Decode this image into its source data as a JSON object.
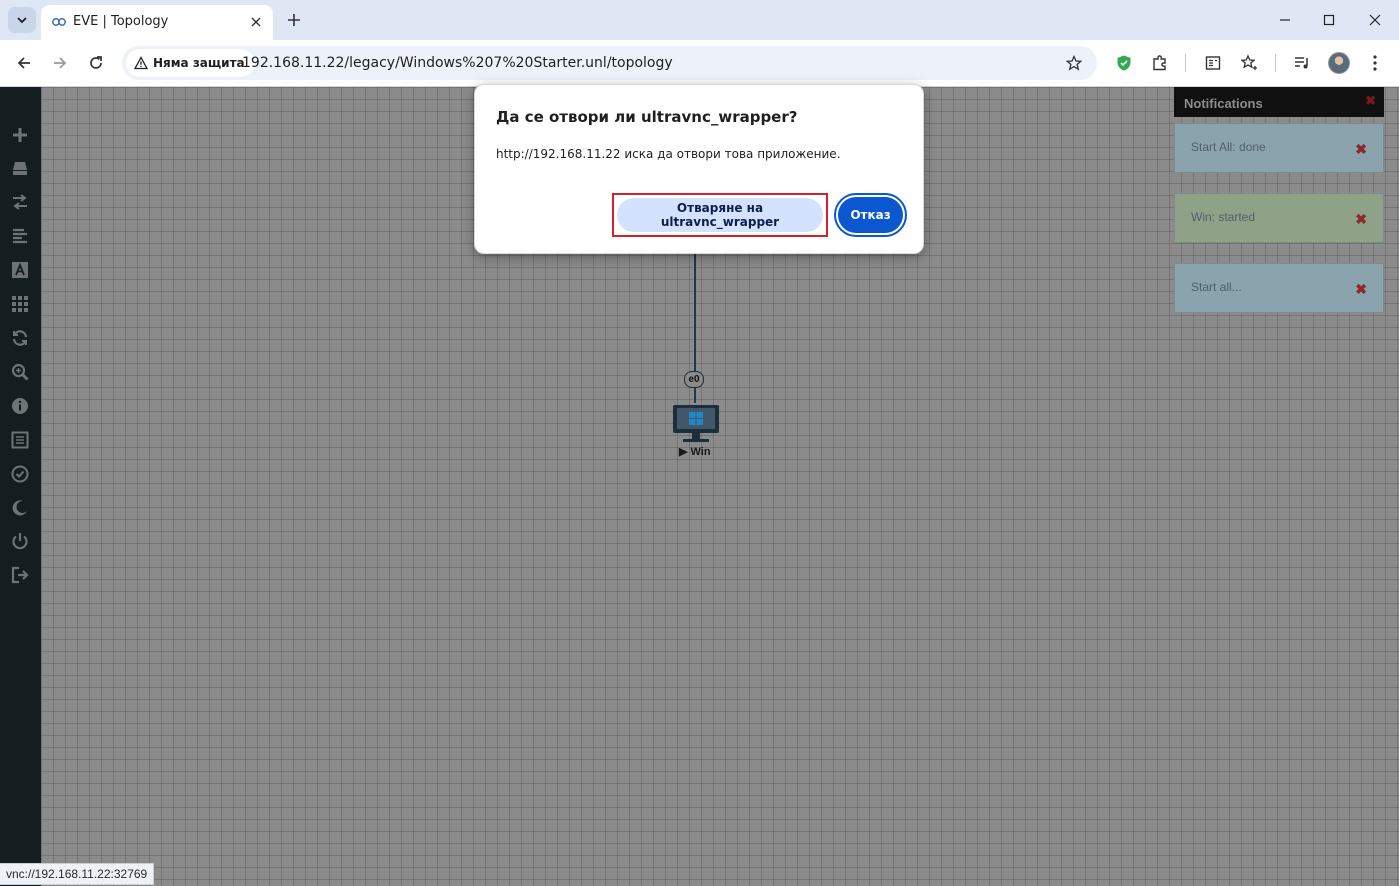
{
  "browser": {
    "tab_title": "EVE | Topology",
    "security_label": "Няма защита",
    "url": "192.168.11.22/legacy/Windows%207%20Starter.unl/topology",
    "status_url": "vnc://192.168.11.22:32769"
  },
  "dialog": {
    "title": "Да се отвори ли ultravnc_wrapper?",
    "message": "http://192.168.11.22 иска да отвори това приложение.",
    "open_label": "Отваряне на ultravnc_wrapper",
    "cancel_label": "Отказ"
  },
  "topology": {
    "interface_label": "e0",
    "node_label": "▶ Win"
  },
  "notifications": {
    "title": "Notifications",
    "items": [
      {
        "text": "Start All: done",
        "color": "#8aa3ad"
      },
      {
        "text": "Win: started",
        "color": "#8fa187"
      },
      {
        "text": "Start all...",
        "color": "#8aa3ad"
      }
    ]
  },
  "sidebar_icons": [
    "add-icon",
    "node-icon",
    "network-icon",
    "list-icon",
    "text-icon",
    "grid-icon",
    "refresh-icon",
    "zoom-icon",
    "info-icon",
    "log-icon",
    "check-icon",
    "moon-icon",
    "power-icon",
    "logout-icon"
  ],
  "colors": {
    "accent": "#0b57d0",
    "highlight": "#d91e2e",
    "sidebar": "#141d1f"
  }
}
